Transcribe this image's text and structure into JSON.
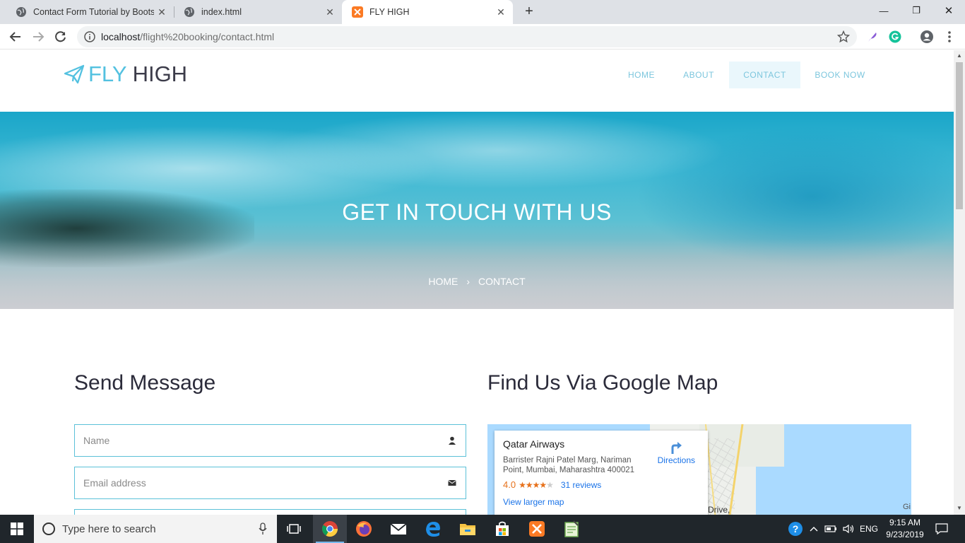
{
  "browser": {
    "tabs": [
      {
        "title": "Contact Form Tutorial by Bootstr",
        "close": "✕"
      },
      {
        "title": "index.html",
        "close": "✕"
      },
      {
        "title": "FLY HIGH",
        "close": "✕"
      }
    ],
    "new_tab": "+",
    "window_controls": {
      "minimize": "—",
      "restore": "❐",
      "close": "✕"
    },
    "url_host": "localhost",
    "url_path": "/flight%20booking/contact.html"
  },
  "site": {
    "logo": {
      "fly": "FLY",
      "high": "HIGH"
    },
    "menu": [
      "HOME",
      "ABOUT",
      "CONTACT",
      "BOOK NOW"
    ],
    "active_menu": "CONTACT",
    "hero_title": "GET IN TOUCH WITH US",
    "breadcrumb": {
      "home": "HOME",
      "sep": "›",
      "current": "CONTACT"
    },
    "send_message": {
      "title": "Send Message",
      "name_placeholder": "Name",
      "email_placeholder": "Email address"
    },
    "map_section": {
      "title": "Find Us Via Google Map",
      "place": "Qatar Airways",
      "address": "Barrister Rajni Patel Marg, Nariman Point, Mumbai, Maharashtra 400021",
      "rating": "4.0",
      "stars": "★★★★★",
      "reviews": "31 reviews",
      "directions": "Directions",
      "larger_map": "View larger map",
      "street_label": "arine Drive,",
      "corner_label": "Gi"
    }
  },
  "taskbar": {
    "search_placeholder": "Type here to search",
    "language": "ENG",
    "time": "9:15 AM",
    "date": "9/23/2019"
  },
  "colors": {
    "accent": "#53c1e0",
    "logo_dark": "#3c3c4a",
    "field_border": "#5cc1d8",
    "link_blue": "#1a73e8",
    "rating_orange": "#e7711b"
  }
}
